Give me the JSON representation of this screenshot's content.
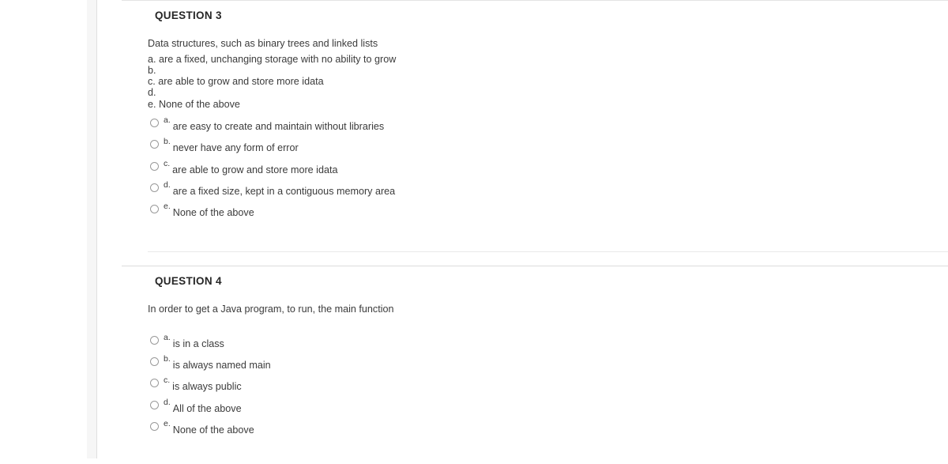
{
  "document": {
    "blocks": [
      {
        "id": "question-3",
        "header": "QUESTION 3",
        "intro": "Data structures, such as binary trees and linked lists",
        "embedded_lines": [
          "a. are a fixed, unchanging storage with no ability to grow",
          "b.",
          "c. are able to grow and store more idata",
          "d.",
          "e. None of the above"
        ],
        "options": [
          {
            "letter": "a.",
            "text": "are easy to create and maintain without libraries",
            "selected": false
          },
          {
            "letter": "b.",
            "text": "never have any form of error",
            "selected": false
          },
          {
            "letter": "c.",
            "text": "are able to grow and store more idata",
            "selected": false
          },
          {
            "letter": "d.",
            "text": "are a fixed size, kept in a contiguous memory area",
            "selected": false
          },
          {
            "letter": "e.",
            "text": "None of the above",
            "selected": false
          }
        ]
      },
      {
        "id": "question-4",
        "header": "QUESTION 4",
        "intro": "In order to get a Java program, to run, the main function",
        "embedded_lines": [],
        "options": [
          {
            "letter": "a.",
            "text": "is in a class",
            "selected": false
          },
          {
            "letter": "b.",
            "text": "is always named main",
            "selected": false
          },
          {
            "letter": "c.",
            "text": "is always public",
            "selected": false
          },
          {
            "letter": "d.",
            "text": "All of the above",
            "selected": false
          },
          {
            "letter": "e.",
            "text": "None of the above",
            "selected": false
          }
        ]
      }
    ]
  },
  "colors": {
    "page_background": "#ffffff",
    "gutter": "#f6f6f6",
    "text": "#3b3b3b",
    "heading": "#262626",
    "rule": "#dcdcdc",
    "radio_border": "#9a9a9a"
  }
}
